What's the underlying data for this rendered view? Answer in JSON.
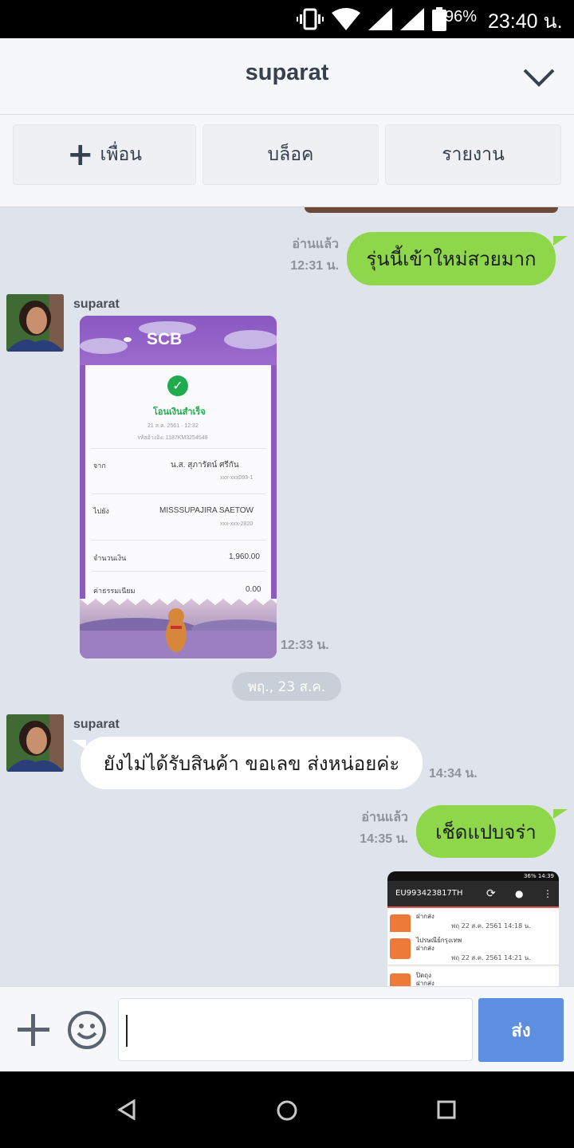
{
  "status_bar": {
    "battery": "96%",
    "time": "23:40 น."
  },
  "header": {
    "title": "suparat"
  },
  "actions": {
    "add_friend": "เพื่อน",
    "block": "บล็อค",
    "report": "รายงาน"
  },
  "messages": [
    {
      "read": "อ่านแล้ว",
      "time": "12:31 น.",
      "text": "รุ่นนี้เข้าใหม่สวยมาก"
    },
    {
      "sender": "suparat",
      "time": "12:33 น.",
      "receipt": {
        "brand": "SCB",
        "status": "โอนเงินสำเร็จ",
        "date": "21 ส.ค. 2561 · 12:32",
        "ref": "รหัสอ้างอิง: 1187KM3254548",
        "from_label": "จาก",
        "from_name": "น.ส. สุภารัตน์ ศรีกัน",
        "from_acct": "xxx-xxx093-1",
        "to_label": "ไปยัง",
        "to_name": "MISSSUPAJIRA SAETOW",
        "to_acct": "xxx-xxx-2820",
        "amount_label": "จำนวนเงิน",
        "amount": "1,960.00",
        "fee_label": "ค่าธรรมเนียม",
        "fee": "0.00"
      }
    },
    {
      "date_chip": "พฤ., 23 ส.ค."
    },
    {
      "sender": "suparat",
      "time": "14:34 น.",
      "text": "ยังไม่ได้รับสินค้า ขอเลข ส่งหน่อยค่ะ"
    },
    {
      "read": "อ่านแล้ว",
      "time": "14:35 น.",
      "text": "เช็ดแปบจร่า"
    },
    {
      "thumbnail": {
        "status": "36% 14:39",
        "tracking": "EU993423817TH",
        "row1_title": "ฝากส่ง",
        "row1_time": "พฤ 22 ส.ค. 2561 14:18 น.",
        "row2_title": "ไปรษณีย์กรุงเทพ",
        "row2_sub": "ฝากส่ง",
        "row2_time": "พฤ 22 ส.ค. 2561 14:21 น.",
        "row3_title": "ปิดถุง",
        "row3_sub": "ฝากส่ง"
      }
    }
  ],
  "input": {
    "send": "ส่ง"
  },
  "colors": {
    "outgoing_bubble": "#8ed74a",
    "incoming_bubble": "#ffffff",
    "send_button": "#5e8ee0",
    "chat_background": "#dfe4ec"
  }
}
